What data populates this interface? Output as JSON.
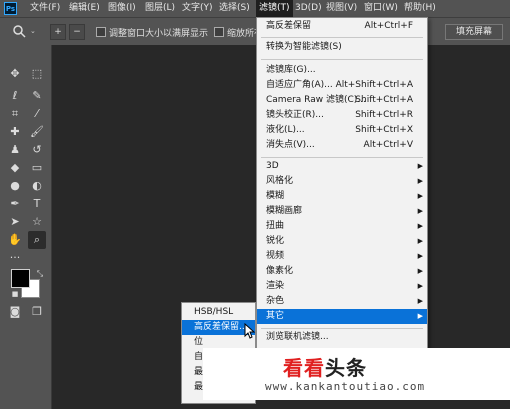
{
  "app": {
    "logo_text": "Ps"
  },
  "menubar": {
    "items": [
      "文件(F)",
      "编辑(E)",
      "图像(I)",
      "图层(L)",
      "文字(Y)",
      "选择(S)",
      "滤镜(T)",
      "3D(D)",
      "视图(V)",
      "窗口(W)",
      "帮助(H)"
    ],
    "active_index": 6
  },
  "options_bar": {
    "zoom_in_icon": "+",
    "zoom_out_icon": "−",
    "resize_windows_label": "调整窗口大小以满屏显示",
    "zoom_all_label": "缩放所有",
    "fill_screen_label": "填充屏幕"
  },
  "filter_menu": {
    "items": [
      {
        "label": "高反差保留",
        "shortcut": "Alt+Ctrl+F"
      },
      {
        "label": "转换为智能滤镜(S)",
        "shortcut": ""
      },
      {
        "label": "滤镜库(G)...",
        "shortcut": ""
      },
      {
        "label": "自适应广角(A)...",
        "shortcut": "Alt+Shift+Ctrl+A"
      },
      {
        "label": "Camera Raw 滤镜(C)...",
        "shortcut": "Shift+Ctrl+A"
      },
      {
        "label": "镜头校正(R)...",
        "shortcut": "Shift+Ctrl+R"
      },
      {
        "label": "液化(L)...",
        "shortcut": "Shift+Ctrl+X"
      },
      {
        "label": "消失点(V)...",
        "shortcut": "Alt+Ctrl+V"
      },
      {
        "label": "3D"
      },
      {
        "label": "风格化"
      },
      {
        "label": "模糊"
      },
      {
        "label": "模糊画廊"
      },
      {
        "label": "扭曲"
      },
      {
        "label": "锐化"
      },
      {
        "label": "视频"
      },
      {
        "label": "像素化"
      },
      {
        "label": "渲染"
      },
      {
        "label": "杂色"
      },
      {
        "label": "其它"
      },
      {
        "label": "浏览联机滤镜..."
      }
    ]
  },
  "other_submenu": {
    "items": [
      "HSB/HSL",
      "高反差保留...",
      "位",
      "自",
      "最",
      "最"
    ]
  },
  "watermark": {
    "logo_a": "看看",
    "logo_b": "头条",
    "url": "www.kankantoutiao.com"
  }
}
